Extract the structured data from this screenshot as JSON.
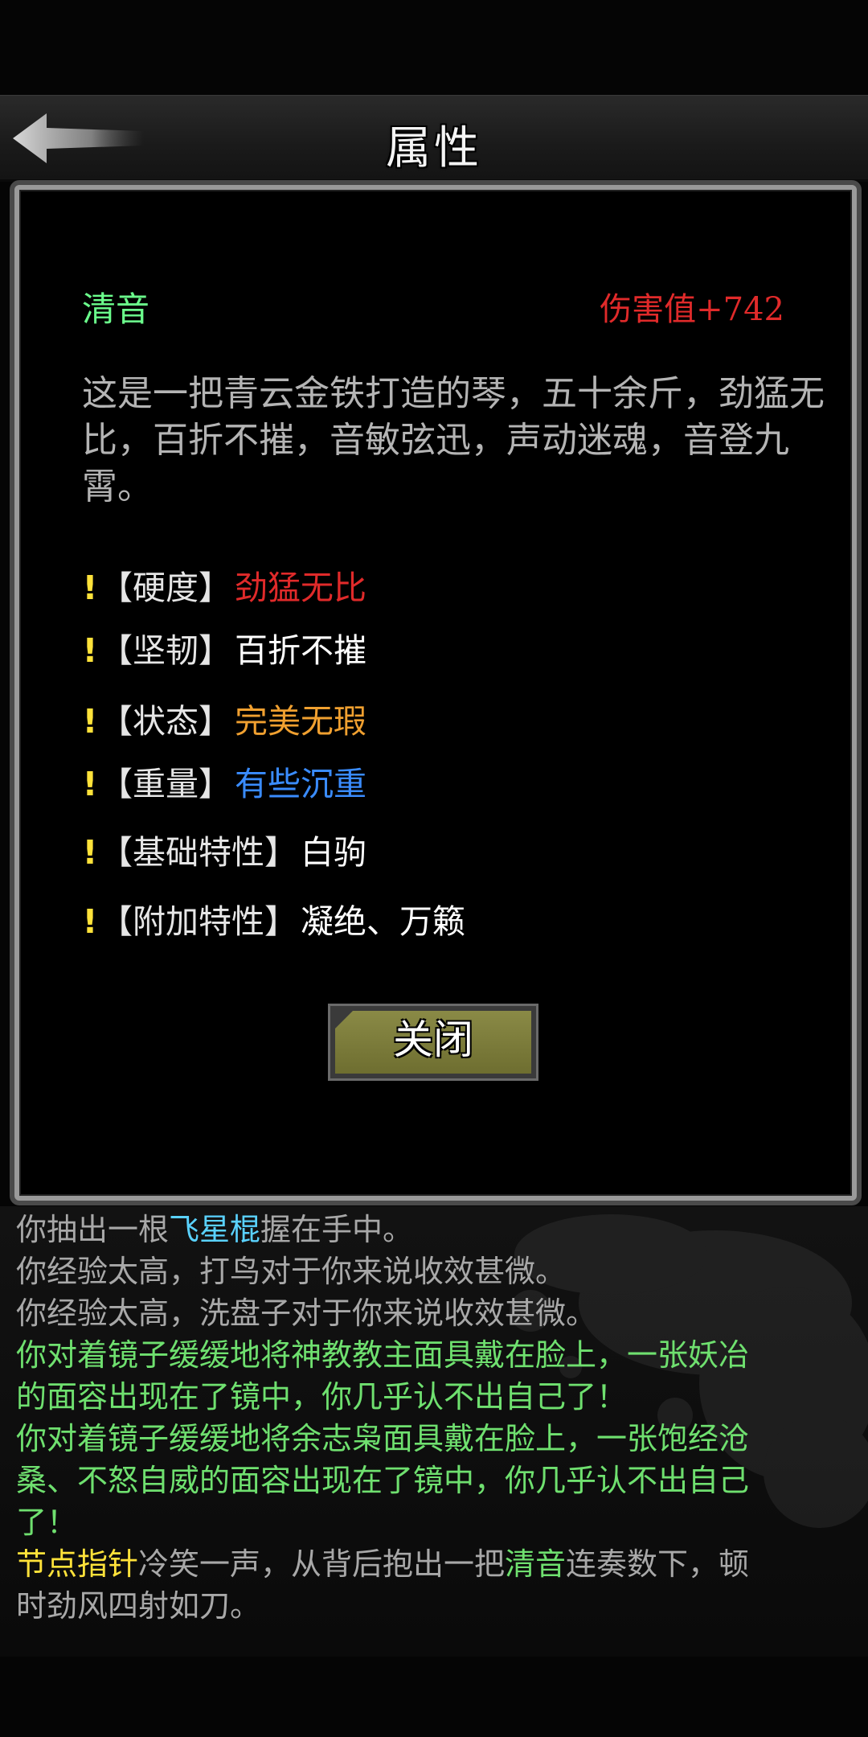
{
  "header": {
    "title": "属性",
    "back_icon": "back-arrow-icon"
  },
  "item": {
    "name": "清音",
    "damage": "伤害值+742",
    "description": "这是一把青云金铁打造的琴，五十余斤，劲猛无比，百折不摧，音敏弦迅，声动迷魂，音登九霄。",
    "attributes": [
      {
        "mark": "!",
        "key": "【硬度】",
        "value": "劲猛无比",
        "color": "#e02a2a"
      },
      {
        "mark": "!",
        "key": "【坚韧】",
        "value": "百折不摧",
        "color": "#ffffff"
      },
      {
        "mark": "!",
        "key": "【状态】",
        "value": "完美无瑕",
        "color": "#f0a030"
      },
      {
        "mark": "!",
        "key": "【重量】",
        "value": "有些沉重",
        "color": "#3a8cff"
      },
      {
        "mark": "!",
        "key": "【基础特性】",
        "value": "白驹",
        "color": "#ffffff"
      },
      {
        "mark": "!",
        "key": "【附加特性】",
        "value": "凝绝、万籁",
        "color": "#ffffff"
      }
    ],
    "close_label": "关闭"
  },
  "log": {
    "l1": {
      "a": "你抽出一根",
      "b": "飞星棍",
      "c": "握在手中。"
    },
    "l2": "你经验太高，打鸟对于你来说收效甚微。",
    "l3": "你经验太高，洗盘子对于你来说收效甚微。",
    "l4a": "你对着镜子缓缓地将神教教主面具戴在脸上，一张妖冶",
    "l4b": "的面容出现在了镜中，你几乎认不出自己了！",
    "l5a": "你对着镜子缓缓地将余志枭面具戴在脸上，一张饱经沧",
    "l5b": "桑、不怒自威的面容出现在了镜中，你几乎认不出自己",
    "l5c": "了！",
    "l6": {
      "a": "节点指针",
      "b": "冷笑一声，从背后抱出一把",
      "c": "清音",
      "d": "连奏数下，顿"
    },
    "l6b": "时劲风四射如刀。"
  }
}
